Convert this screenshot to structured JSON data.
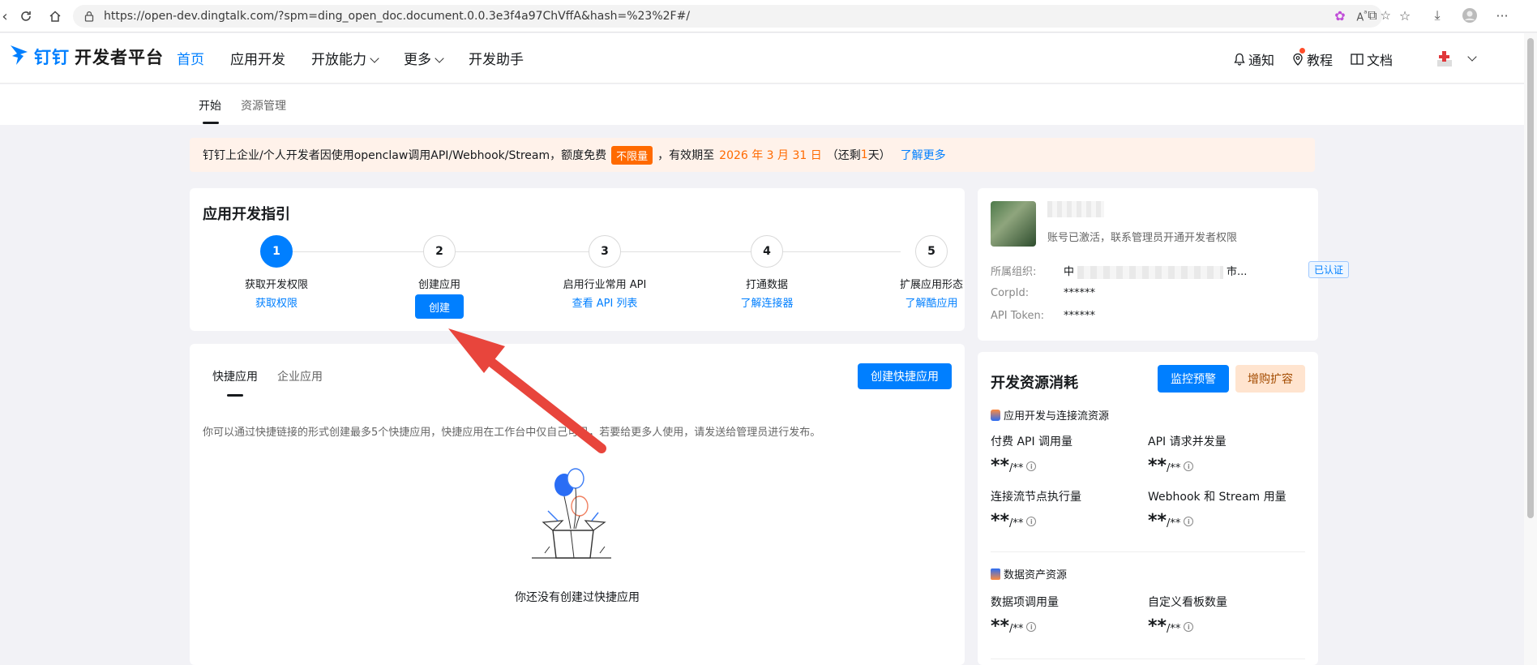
{
  "browser": {
    "url": "https://open-dev.dingtalk.com/?spm=ding_open_doc.document.0.0.3e3f4a97ChVffA&hash=%23%2F#/"
  },
  "topnav": {
    "logo_ding": "钉钉",
    "logo_text": "开发者平台",
    "items": [
      {
        "label": "首页"
      },
      {
        "label": "应用开发"
      },
      {
        "label": "开放能力"
      },
      {
        "label": "更多"
      },
      {
        "label": "开发助手"
      }
    ],
    "right": {
      "notify": "通知",
      "tutorial": "教程",
      "docs": "文档"
    }
  },
  "subnav": {
    "tabs": [
      {
        "label": "开始"
      },
      {
        "label": "资源管理"
      }
    ]
  },
  "notice": {
    "text1": "钉钉上企业/个人开发者因使用openclaw调用API/Webhook/Stream，额度免费",
    "badge": "不限量",
    "text2": "，有效期至",
    "date": "2026 年 3 月 31 日",
    "text3": "（还剩",
    "days": "1",
    "text4": "天）",
    "link": "了解更多"
  },
  "guide": {
    "title": "应用开发指引",
    "steps": [
      {
        "num": "1",
        "label": "获取开发权限",
        "link": "获取权限"
      },
      {
        "num": "2",
        "label": "创建应用",
        "button": "创建"
      },
      {
        "num": "3",
        "label": "启用行业常用 API",
        "link": "查看 API 列表"
      },
      {
        "num": "4",
        "label": "打通数据",
        "link": "了解连接器"
      },
      {
        "num": "5",
        "label": "扩展应用形态",
        "link": "了解酷应用"
      }
    ]
  },
  "profile": {
    "status": "账号已激活，联系管理员开通开发者权限",
    "org_label": "所属组织:",
    "org_value_start": "中",
    "org_value_end": "市...",
    "verified": "已认证",
    "corp_label": "CorpId:",
    "corp_value": "******",
    "token_label": "API Token:",
    "token_value": "******"
  },
  "apps": {
    "tabs": [
      {
        "label": "快捷应用"
      },
      {
        "label": "企业应用"
      }
    ],
    "create_btn": "创建快捷应用",
    "desc": "你可以通过快捷链接的形式创建最多5个快捷应用，快捷应用在工作台中仅自己可见，若要给更多人使用，请发送给管理员进行发布。",
    "empty": "你还没有创建过快捷应用"
  },
  "resources": {
    "title": "开发资源消耗",
    "monitor_btn": "监控预警",
    "buy_btn": "增购扩容",
    "section1": "应用开发与连接流资源",
    "section2": "数据资产资源",
    "metrics": [
      {
        "label": "付费 API 调用量",
        "value": "**",
        "total": "/**"
      },
      {
        "label": "API 请求并发量",
        "value": "**",
        "total": "/**"
      },
      {
        "label": "连接流节点执行量",
        "value": "**",
        "total": "/**"
      },
      {
        "label": "Webhook 和 Stream 用量",
        "value": "**",
        "total": "/**"
      },
      {
        "label": "数据项调用量",
        "value": "**",
        "total": "/**"
      },
      {
        "label": "自定义看板数量",
        "value": "**",
        "total": "/**"
      }
    ]
  },
  "colors": {
    "brand": "#007fff",
    "orange": "#ff6a00",
    "arrow": "#e8453c"
  }
}
